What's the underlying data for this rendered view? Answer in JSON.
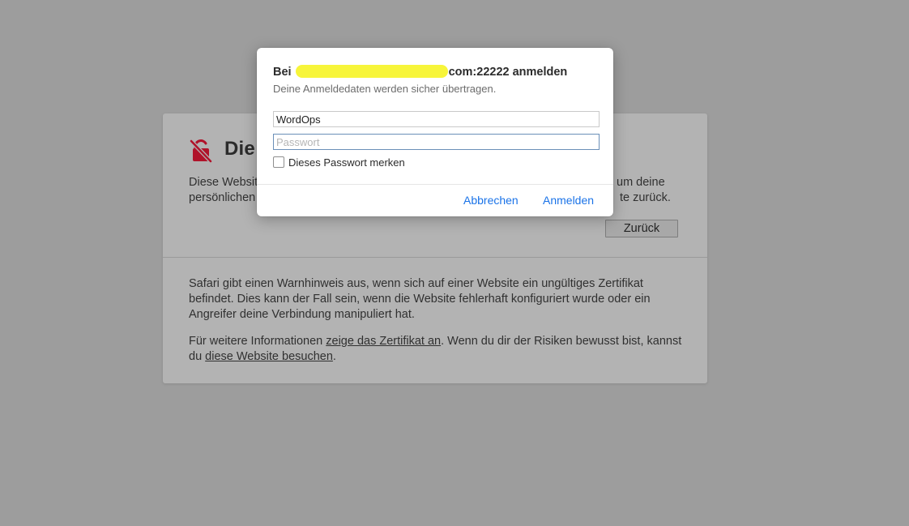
{
  "warning": {
    "title": "Die",
    "text_line1_start": "Diese Websit",
    "text_line1_end": "um deine",
    "text_line2_start": "persönlichen",
    "text_line2_end": "te zurück.",
    "back_label": "Zurück",
    "explain": "Safari gibt einen Warnhinweis aus, wenn sich auf einer Website ein ungültiges Zertifikat befindet. Dies kann der Fall sein, wenn die Website fehlerhaft konfiguriert wurde oder ein Angreifer deine Verbindung manipuliert hat.",
    "more_prefix": "Für weitere Informationen ",
    "show_cert_link": "zeige das Zertifikat an",
    "more_middle": ". Wenn du dir der Risiken bewusst bist, kannst du ",
    "visit_link": "diese Website besuchen",
    "more_suffix": "."
  },
  "dialog": {
    "title_prefix": "Bei",
    "title_suffix": "com:22222 anmelden",
    "subtitle": "Deine Anmeldedaten werden sicher übertragen.",
    "username_value": "WordOps",
    "password_placeholder": "Passwort",
    "remember_label": "Dieses Passwort merken",
    "cancel_label": "Abbrechen",
    "login_label": "Anmelden"
  },
  "colors": {
    "accent": "#1a73e8",
    "warning_icon": "#b0132a",
    "redaction": "#f7f53a"
  }
}
